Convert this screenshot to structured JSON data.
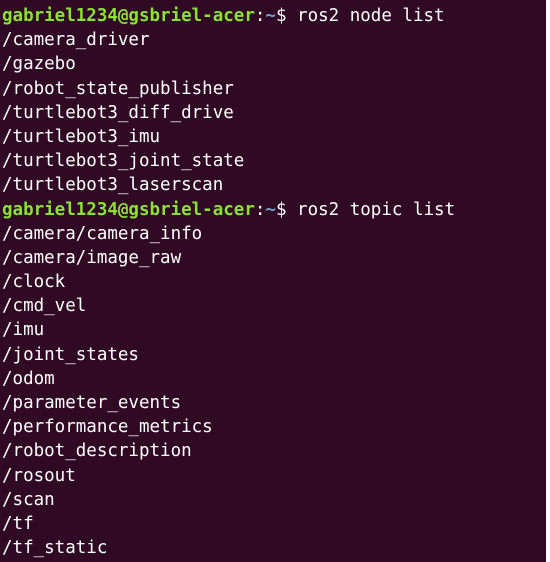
{
  "terminal": {
    "prompt": {
      "user_host": "gabriel1234@gsbriel-acer",
      "separator": ":",
      "path": "~",
      "symbol": "$ "
    },
    "commands": {
      "first": "ros2 node list",
      "second": "ros2 topic list"
    },
    "node_list": [
      "/camera_driver",
      "/gazebo",
      "/robot_state_publisher",
      "/turtlebot3_diff_drive",
      "/turtlebot3_imu",
      "/turtlebot3_joint_state",
      "/turtlebot3_laserscan"
    ],
    "topic_list": [
      "/camera/camera_info",
      "/camera/image_raw",
      "/clock",
      "/cmd_vel",
      "/imu",
      "/joint_states",
      "/odom",
      "/parameter_events",
      "/performance_metrics",
      "/robot_description",
      "/rosout",
      "/scan",
      "/tf",
      "/tf_static"
    ],
    "colors": {
      "background": "#300a24",
      "user_host": "#8ae234",
      "path": "#729fcf",
      "text": "#ffffff"
    }
  }
}
